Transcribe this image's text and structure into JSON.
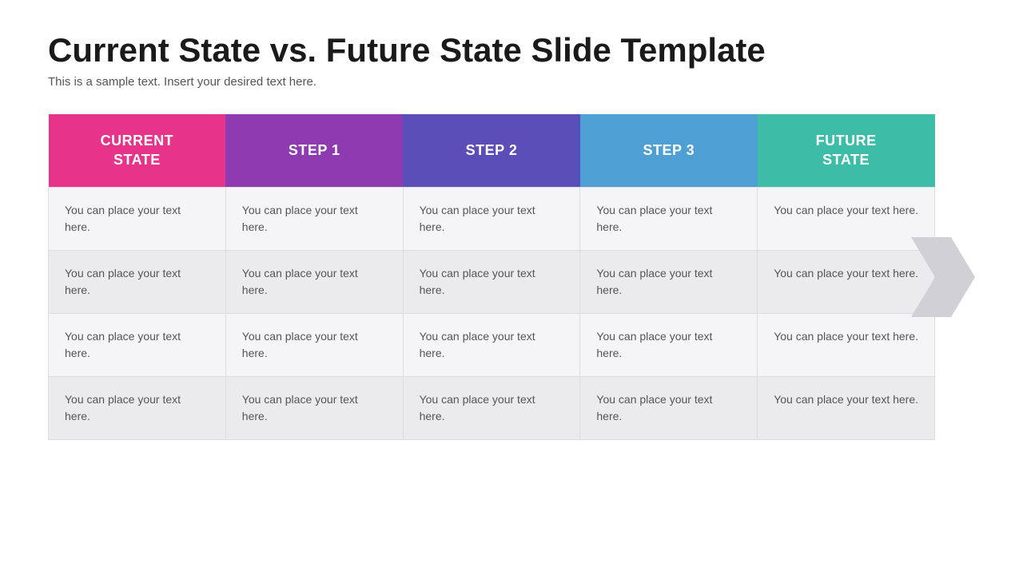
{
  "page": {
    "title": "Current State vs. Future State Slide Template",
    "subtitle": "This is a sample text. Insert your desired text here."
  },
  "table": {
    "headers": [
      {
        "id": "current",
        "label": "CURRENT\nSTATE",
        "color": "#e8338a"
      },
      {
        "id": "step1",
        "label": "STEP 1",
        "color": "#8e3ab0"
      },
      {
        "id": "step2",
        "label": "STEP 2",
        "color": "#5b4eb8"
      },
      {
        "id": "step3",
        "label": "STEP 3",
        "color": "#4ea0d4"
      },
      {
        "id": "future",
        "label": "FUTURE\nSTATE",
        "color": "#3dbda8"
      }
    ],
    "cell_text": "You can place your text here.",
    "rows": 4,
    "cols": 5
  },
  "arrow": {
    "color": "#d0d0d5"
  }
}
